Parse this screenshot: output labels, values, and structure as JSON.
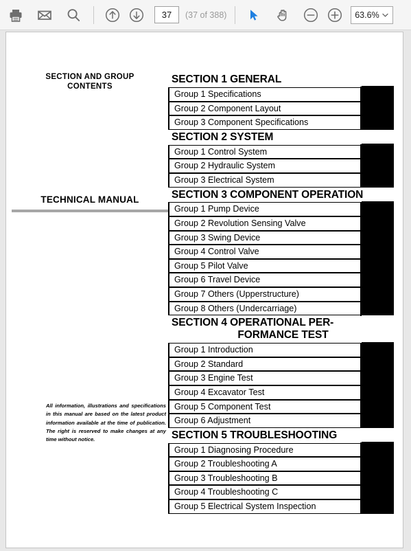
{
  "toolbar": {
    "print_label": "Print",
    "email_label": "Email",
    "search_label": "Search",
    "prev_page_label": "Previous Page",
    "next_page_label": "Next Page",
    "page_number": "37",
    "page_count_text": "(37 of 388)",
    "select_tool_label": "Select",
    "hand_tool_label": "Pan",
    "zoom_out_label": "Zoom Out",
    "zoom_in_label": "Zoom In",
    "zoom_level": "63.6%",
    "accent_color": "#1f7fe0",
    "icon_color": "#6e6e6e",
    "background_color": "#f5f5f5"
  },
  "document": {
    "contents_title_line1": "SECTION AND GROUP",
    "contents_title_line2": "CONTENTS",
    "manual_title": "TECHNICAL MANUAL",
    "disclaimer": "All information, illustrations and specifications in this manual are based on the latest product information available at the time of publication. The right is reserved to make changes at any time without notice.",
    "sections": [
      {
        "heading": "SECTION 1 GENERAL",
        "heading_line2": "",
        "groups": [
          {
            "label": "Group 1 Specifications",
            "tab_block": 0
          },
          {
            "label": "Group 2 Component Layout",
            "tab_block": 1
          },
          {
            "label": "Group 3 Component Specifications",
            "tab_block": 2
          }
        ]
      },
      {
        "heading": "SECTION 2 SYSTEM",
        "heading_line2": "",
        "groups": [
          {
            "label": "Group 1 Control System",
            "tab_block": 0
          },
          {
            "label": "Group 2 Hydraulic System",
            "tab_block": 0
          },
          {
            "label": "Group 3 Electrical System",
            "tab_block": 0
          }
        ]
      },
      {
        "heading": "SECTION 3 COMPONENT OPERATION",
        "heading_line2": "",
        "groups": [
          {
            "label": "Group 1 Pump Device",
            "tab_block": 0
          },
          {
            "label": "Group 2 Revolution Sensing Valve",
            "tab_block": 0
          },
          {
            "label": "Group 3 Swing Device",
            "tab_block": 0
          },
          {
            "label": "Group 4 Control Valve",
            "tab_block": 1
          },
          {
            "label": "Group 5 Pilot Valve",
            "tab_block": 1
          },
          {
            "label": "Group 6 Travel Device",
            "tab_block": 1
          },
          {
            "label": "Group 7 Others (Upperstructure)",
            "tab_block": 1
          },
          {
            "label": "Group 8 Others (Undercarriage)",
            "tab_block": 1
          }
        ]
      },
      {
        "heading": "SECTION 4  OPERATIONAL PER-",
        "heading_line2": "FORMANCE TEST",
        "groups": [
          {
            "label": "Group 1 Introduction",
            "tab_block": 0
          },
          {
            "label": "Group 2 Standard",
            "tab_block": 0
          },
          {
            "label": "Group 3 Engine Test",
            "tab_block": 0
          },
          {
            "label": "Group 4 Excavator Test",
            "tab_block": 1
          },
          {
            "label": "Group 5 Component Test",
            "tab_block": 2
          },
          {
            "label": "Group 6 Adjustment",
            "tab_block": 3
          }
        ]
      },
      {
        "heading": "SECTION 5 TROUBLESHOOTING",
        "heading_line2": "",
        "groups": [
          {
            "label": "Group 1 Diagnosing Procedure",
            "tab_block": 0
          },
          {
            "label": "Group 2 Troubleshooting A",
            "tab_block": 0
          },
          {
            "label": "Group 3 Troubleshooting B",
            "tab_block": 0
          },
          {
            "label": "Group 4 Troubleshooting C",
            "tab_block": 0
          },
          {
            "label": "Group 5 Electrical System Inspection",
            "tab_block": 1
          }
        ]
      }
    ]
  }
}
